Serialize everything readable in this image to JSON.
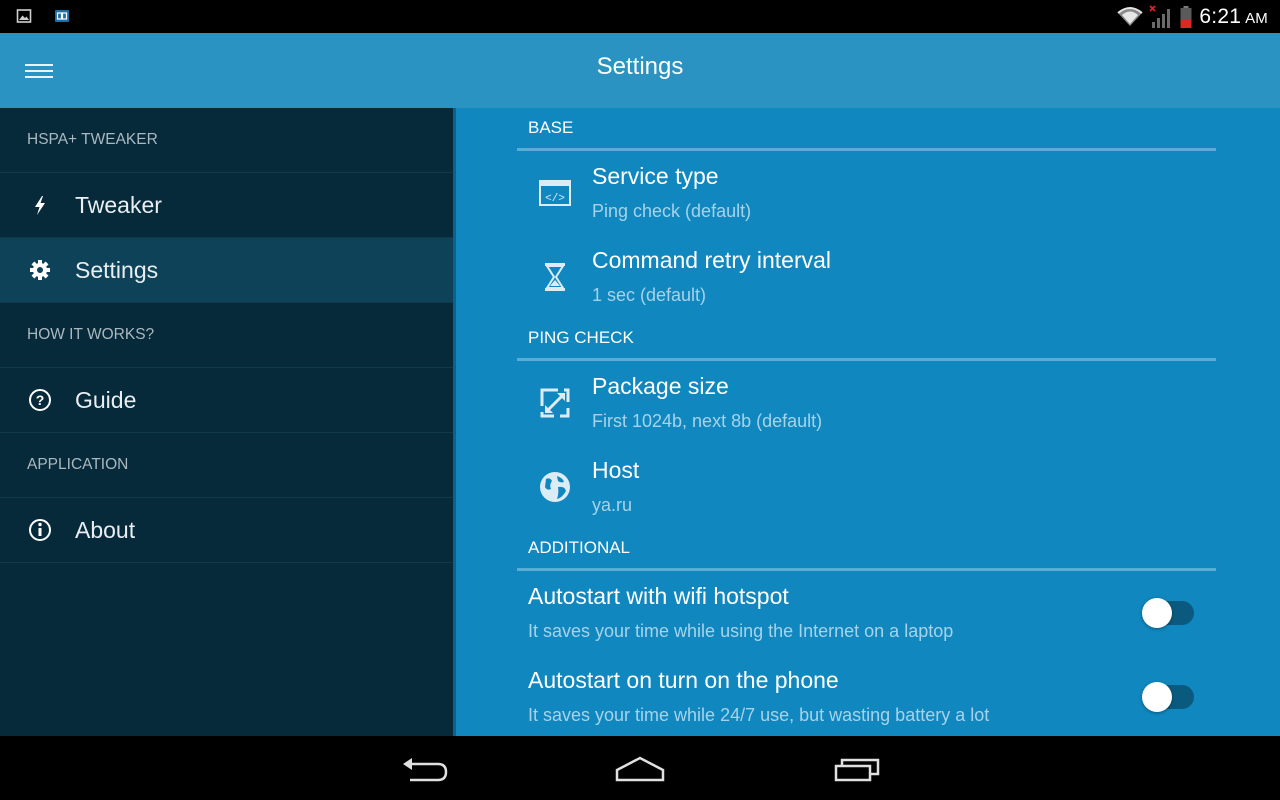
{
  "status_bar": {
    "time": "6:21",
    "ampm": "AM",
    "left_icons": [
      "image-notification-icon",
      "app-notification-icon"
    ],
    "right_icons": [
      "wifi-icon",
      "signal-no-service-icon",
      "battery-low-icon"
    ]
  },
  "app_bar": {
    "title": "Settings",
    "menu_icon": "hamburger-menu-icon"
  },
  "drawer": {
    "sections": [
      {
        "header": "HSPA+ TWEAKER",
        "items": [
          {
            "label": "Tweaker",
            "icon": "lightning-icon",
            "active": false
          },
          {
            "label": "Settings",
            "icon": "gear-icon",
            "active": true
          }
        ]
      },
      {
        "header": "HOW IT WORKS?",
        "items": [
          {
            "label": "Guide",
            "icon": "help-circle-icon",
            "active": false
          }
        ]
      },
      {
        "header": "APPLICATION",
        "items": [
          {
            "label": "About",
            "icon": "info-circle-icon",
            "active": false
          }
        ]
      }
    ]
  },
  "settings": {
    "base": {
      "title": "BASE",
      "service_type": {
        "title": "Service type",
        "summary": "Ping check (default)",
        "icon": "code-window-icon"
      },
      "retry_interval": {
        "title": "Command retry interval",
        "summary": "1 sec (default)",
        "icon": "hourglass-icon"
      }
    },
    "ping_check": {
      "title": "PING CHECK",
      "package_size": {
        "title": "Package size",
        "summary": "First 1024b, next 8b (default)",
        "icon": "resize-icon"
      },
      "host": {
        "title": "Host",
        "summary": "ya.ru",
        "icon": "globe-icon"
      }
    },
    "additional": {
      "title": "ADDITIONAL",
      "wifi_hotspot": {
        "title": "Autostart with wifi hotspot",
        "summary": "It saves your time while using the Internet on a laptop",
        "enabled": false
      },
      "turn_on_phone": {
        "title": "Autostart on turn on the phone",
        "summary": "It saves your time while 24/7 use, but wasting battery a lot",
        "enabled": false
      }
    }
  },
  "nav_bar": {
    "buttons": [
      "back-icon",
      "home-icon",
      "recents-icon"
    ]
  },
  "colors": {
    "app_bar": "#2a93c2",
    "drawer": "#062a3a",
    "drawer_active": "#0d4259",
    "content": "#1087be",
    "summary_text": "#a7d3ea"
  }
}
